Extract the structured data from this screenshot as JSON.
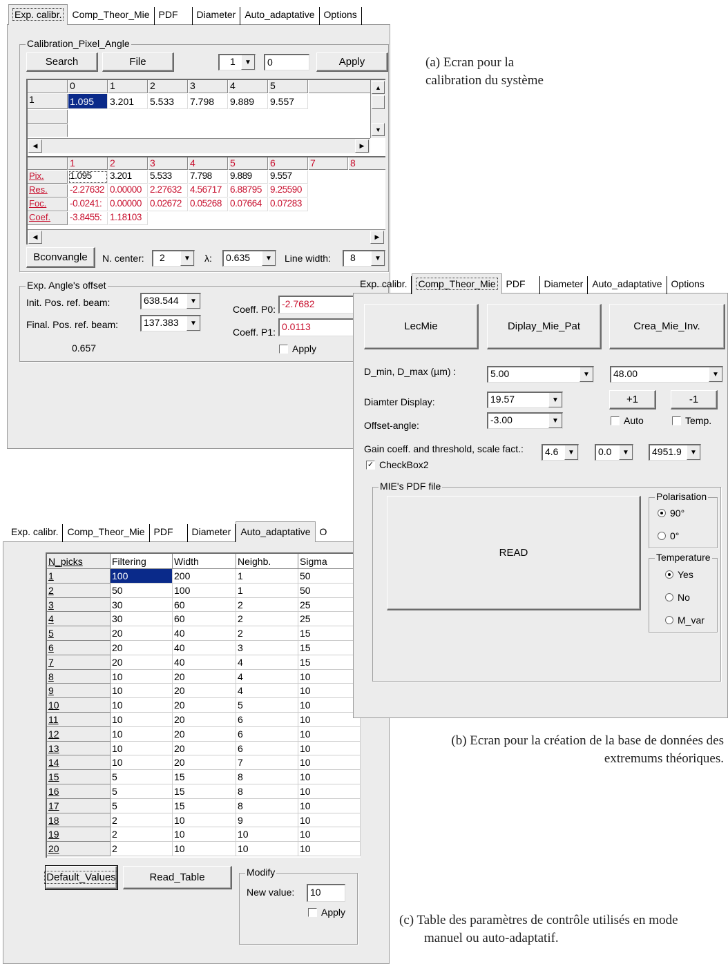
{
  "panel_a": {
    "tabs": [
      "Exp. calibr.",
      "Comp_Theor_Mie",
      "PDF",
      "Diameter",
      "Auto_adaptative",
      "Options"
    ],
    "group_calibration": "Calibration_Pixel_Angle",
    "search_label": "Search",
    "file_label": "File",
    "combo_index": "1",
    "index_value": "0",
    "apply_label": "Apply",
    "grid1": {
      "headers": [
        "0",
        "1",
        "2",
        "3",
        "4",
        "5"
      ],
      "row_label": "1",
      "values": [
        "1.095",
        "3.201",
        "5.533",
        "7.798",
        "9.889",
        "9.557"
      ]
    },
    "grid2": {
      "headers": [
        "1",
        "2",
        "3",
        "4",
        "5",
        "6",
        "7",
        "8"
      ],
      "rows": [
        {
          "label": "Pix.",
          "values": [
            "1.095",
            "3.201",
            "5.533",
            "7.798",
            "9.889",
            "9.557"
          ]
        },
        {
          "label": "Res.",
          "values": [
            "-2.27632",
            "0.00000",
            "2.27632",
            "4.56717",
            "6.88795",
            "9.25590"
          ]
        },
        {
          "label": "Foc.",
          "values": [
            "-0.0241:",
            "0.00000",
            "0.02672",
            "0.05268",
            "0.07664",
            "0.07283"
          ]
        },
        {
          "label": "Coef.",
          "values": [
            "-3.8455:",
            "1.18103"
          ]
        }
      ]
    },
    "bconv_label": "Bconvangle",
    "n_center_label": "N. center:",
    "n_center_value": "2",
    "lambda_label": "λ:",
    "lambda_value": "0.635",
    "line_width_label": "Line width:",
    "line_width_value": "8",
    "group_offset": "Exp. Angle's offset",
    "init_pos_label": "Init. Pos. ref. beam:",
    "init_pos_value": "638.544",
    "final_pos_label": "Final. Pos. ref. beam:",
    "final_pos_value": "137.383",
    "offset_result": "0.657",
    "coeff_p0_label": "Coeff. P0:",
    "coeff_p0_value": "-2.7682",
    "coeff_p1_label": "Coeff. P1:",
    "coeff_p1_value": "0.0113",
    "offset_apply_label": "Apply"
  },
  "panel_b": {
    "tabs": [
      "Exp. calibr.",
      "Comp_Theor_Mie",
      "PDF",
      "Diameter",
      "Auto_adaptative",
      "Options"
    ],
    "lecmie_label": "LecMie",
    "display_label": "Diplay_Mie_Pat",
    "crea_label": "Crea_Mie_Inv.",
    "dmin_dmax_label": "D_min, D_max (µm) :",
    "dmin_value": "5.00",
    "dmax_value": "48.00",
    "diameter_display_label": "Diamter Display:",
    "diameter_display_value": "19.57",
    "plus_label": "+1",
    "minus_label": "-1",
    "offset_angle_label": "Offset-angle:",
    "offset_angle_value": "-3.00",
    "auto_label": "Auto",
    "temp_label": "Temp.",
    "gain_label": "Gain coeff. and threshold, scale fact.:",
    "gain_value": "4.6",
    "threshold_value": "0.0",
    "scale_value": "4951.9",
    "checkbox2_label": "CheckBox2",
    "mie_group_label": "MIE's PDF file",
    "read_label": "READ",
    "polarisation_label": "Polarisation",
    "pol_options": [
      "90°",
      "0°"
    ],
    "temperature_label": "Temperature",
    "temp_options": [
      "Yes",
      "No",
      "M_var"
    ]
  },
  "panel_c": {
    "tabs": [
      "Exp. calibr.",
      "Comp_Theor_Mie",
      "PDF",
      "Diameter",
      "Auto_adaptative",
      "O"
    ],
    "columns": [
      "N_picks",
      "Filtering",
      "Width",
      "Neighb.",
      "Sigma"
    ],
    "rows": [
      [
        "1",
        "100",
        "200",
        "1",
        "50"
      ],
      [
        "2",
        "50",
        "100",
        "1",
        "50"
      ],
      [
        "3",
        "30",
        "60",
        "2",
        "25"
      ],
      [
        "4",
        "30",
        "60",
        "2",
        "25"
      ],
      [
        "5",
        "20",
        "40",
        "2",
        "15"
      ],
      [
        "6",
        "20",
        "40",
        "3",
        "15"
      ],
      [
        "7",
        "20",
        "40",
        "4",
        "15"
      ],
      [
        "8",
        "10",
        "20",
        "4",
        "10"
      ],
      [
        "9",
        "10",
        "20",
        "4",
        "10"
      ],
      [
        "10",
        "10",
        "20",
        "5",
        "10"
      ],
      [
        "11",
        "10",
        "20",
        "6",
        "10"
      ],
      [
        "12",
        "10",
        "20",
        "6",
        "10"
      ],
      [
        "13",
        "10",
        "20",
        "6",
        "10"
      ],
      [
        "14",
        "10",
        "20",
        "7",
        "10"
      ],
      [
        "15",
        "5",
        "15",
        "8",
        "10"
      ],
      [
        "16",
        "5",
        "15",
        "8",
        "10"
      ],
      [
        "17",
        "5",
        "15",
        "8",
        "10"
      ],
      [
        "18",
        "2",
        "10",
        "9",
        "10"
      ],
      [
        "19",
        "2",
        "10",
        "10",
        "10"
      ],
      [
        "20",
        "2",
        "10",
        "10",
        "10"
      ]
    ],
    "default_values_label": "Default_Values",
    "read_table_label": "Read_Table",
    "modify_label": "Modify",
    "new_value_label": "New value:",
    "new_value": "10",
    "apply_label": "Apply"
  },
  "captions": {
    "a": "(a) Ecran pour la calibration du système",
    "b": "(b) Ecran pour la création de la base de données des extremums théoriques.",
    "c": "(c) Table des paramètres de contrôle utilisés en mode manuel ou auto-adaptatif."
  }
}
